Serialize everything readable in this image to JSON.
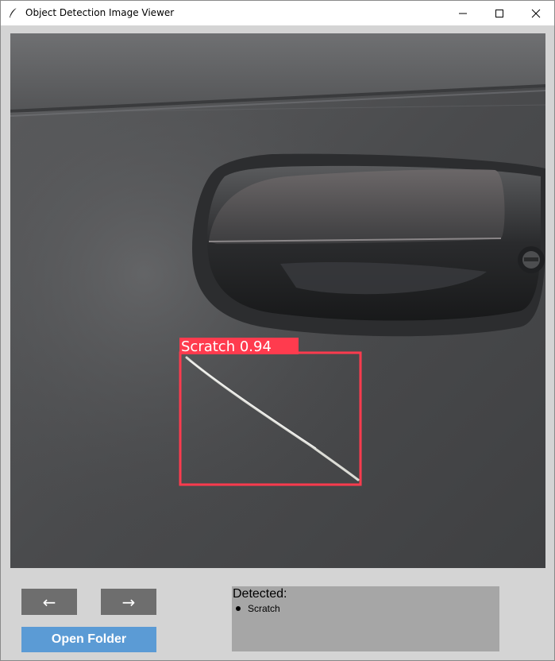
{
  "window": {
    "title": "Object Detection Image Viewer",
    "controls": [
      "minimize-icon",
      "maximize-icon",
      "close-icon"
    ]
  },
  "image": {
    "description_colors": {
      "box": "#ff3b4e",
      "label_bg": "#ff3b4e",
      "label_text": "#ffffff"
    },
    "detections": [
      {
        "label": "Scratch 0.94",
        "class": "Scratch",
        "confidence": 0.94
      }
    ]
  },
  "nav": {
    "prev_label": "←",
    "next_label": "→"
  },
  "open_folder_label": "Open Folder",
  "panel": {
    "title": "Detected:",
    "items": [
      "Scratch"
    ]
  },
  "colors": {
    "nav_button": "#6e6e6e",
    "open_button": "#5b9bd5",
    "panel_bg": "#a6a6a6",
    "window_bg": "#d4d4d4"
  }
}
